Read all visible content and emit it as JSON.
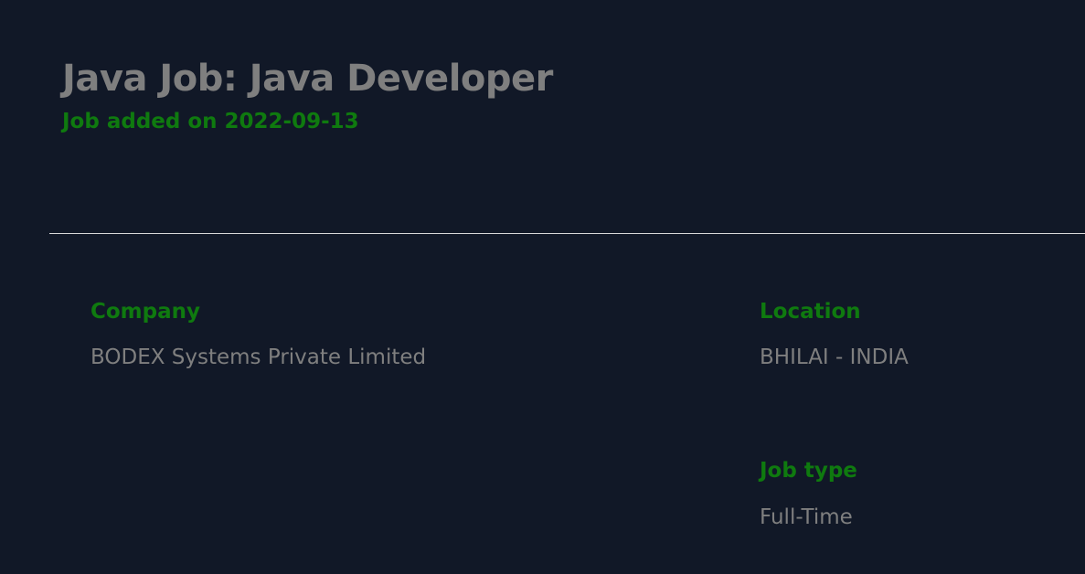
{
  "header": {
    "title": "Java Job: Java Developer",
    "date_line": "Job added on 2022-09-13"
  },
  "details": {
    "company": {
      "label": "Company",
      "value": "BODEX Systems Private Limited"
    },
    "location": {
      "label": "Location",
      "value": "BHILAI - INDIA"
    },
    "job_type": {
      "label": "Job type",
      "value": "Full-Time"
    }
  },
  "colors": {
    "background": "#111827",
    "accent_green": "#0f7a0f",
    "text_gray": "#7f7f7f",
    "divider": "#d9d9d9"
  }
}
